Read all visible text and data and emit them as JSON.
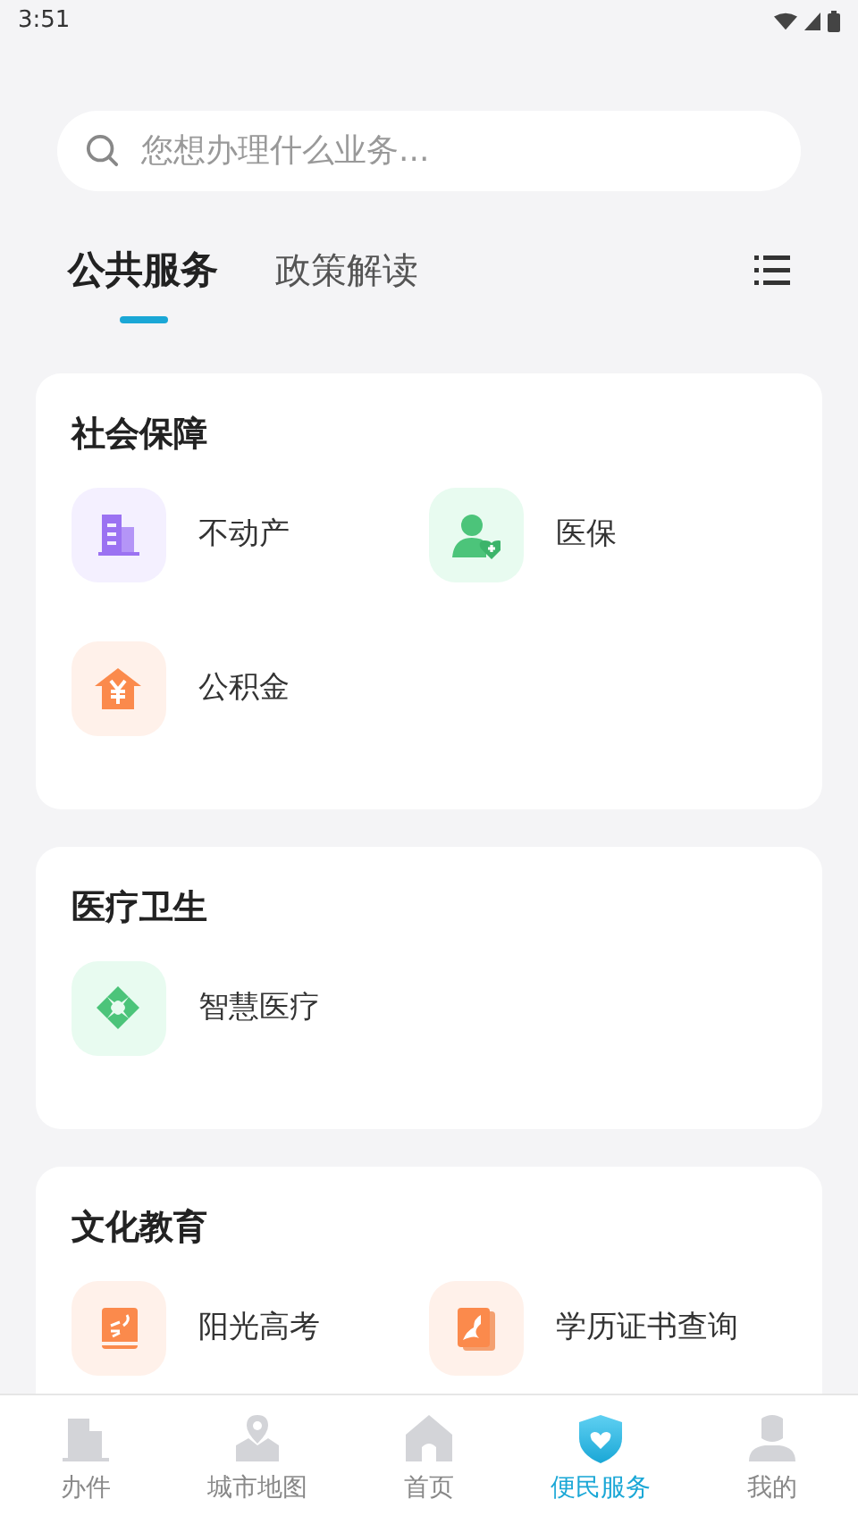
{
  "status_bar": {
    "time": "3:51"
  },
  "search": {
    "placeholder": "您想办理什么业务..."
  },
  "tabs": [
    {
      "label": "公共服务",
      "selected": true
    },
    {
      "label": "政策解读",
      "selected": false
    }
  ],
  "sections": [
    {
      "title": "社会保障",
      "items": [
        {
          "label": "不动产"
        },
        {
          "label": "医保"
        },
        {
          "label": "公积金"
        }
      ]
    },
    {
      "title": "医疗卫生",
      "items": [
        {
          "label": "智慧医疗"
        }
      ]
    },
    {
      "title": "文化教育",
      "items": [
        {
          "label": "阳光高考"
        },
        {
          "label": "学历证书查询"
        }
      ]
    }
  ],
  "bottom_nav": [
    {
      "label": "办件",
      "selected": false
    },
    {
      "label": "城市地图",
      "selected": false
    },
    {
      "label": "首页",
      "selected": false
    },
    {
      "label": "便民服务",
      "selected": true
    },
    {
      "label": "我的",
      "selected": false
    }
  ]
}
